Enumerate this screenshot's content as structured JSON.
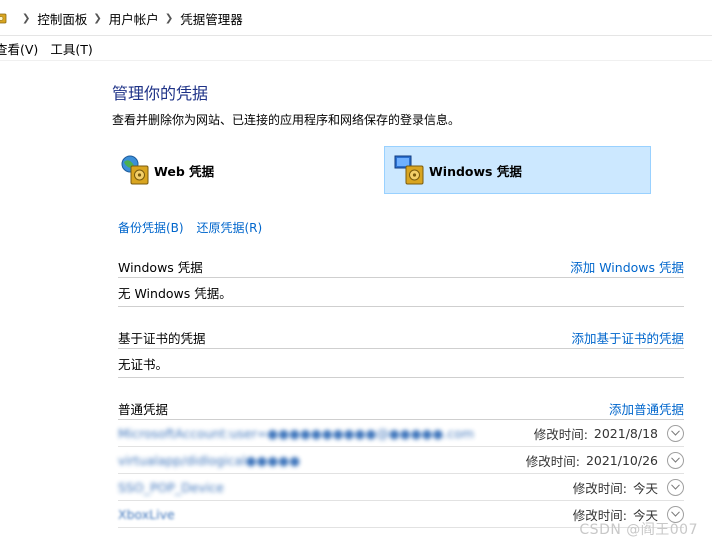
{
  "breadcrumb": [
    "控制面板",
    "用户帐户",
    "凭据管理器"
  ],
  "menu": [
    "查看(V)",
    "工具(T)"
  ],
  "page": {
    "title": "管理你的凭据",
    "description": "查看并删除你为网站、已连接的应用程序和网络保存的登录信息。"
  },
  "credential_types": {
    "web": "Web 凭据",
    "windows": "Windows 凭据",
    "selected": "windows"
  },
  "actions": {
    "backup": "备份凭据(B)",
    "restore": "还原凭据(R)"
  },
  "sections": {
    "windows": {
      "title": "Windows 凭据",
      "action": "添加 Windows 凭据",
      "empty": "无 Windows 凭据。"
    },
    "certificate": {
      "title": "基于证书的凭据",
      "action": "添加基于证书的凭据",
      "empty": "无证书。"
    },
    "generic": {
      "title": "普通凭据",
      "action": "添加普通凭据",
      "items": [
        {
          "name": "MicrosoftAccount:user=●●●●●●●●●●@●●●●●.com",
          "time_label": "修改时间:",
          "time": "2021/8/18"
        },
        {
          "name": "virtualapp/didlogical●●●●●",
          "time_label": "修改时间:",
          "time": "2021/10/26"
        },
        {
          "name": "SSO_POP_Device",
          "time_label": "修改时间:",
          "time": "今天"
        },
        {
          "name": "XboxLive",
          "time_label": "修改时间:",
          "time": "今天"
        }
      ]
    }
  },
  "watermark": "CSDN @阎王007"
}
